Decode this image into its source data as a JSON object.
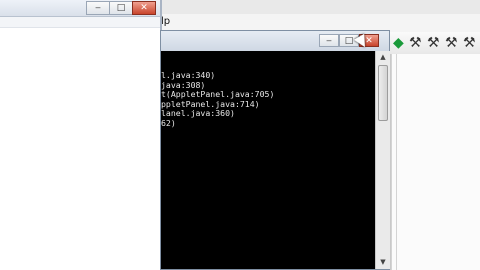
{
  "ide": {
    "menu_fragment": "lp"
  },
  "console": {
    "title_buttons": {
      "minimize": "‒",
      "maximize": "□",
      "close": "✕"
    },
    "lines": [
      "l.java:340)",
      "java:308)",
      "t(AppletPanel.java:705)",
      "ppletPanel.java:714)",
      "lanel.java:360)",
      "62)"
    ]
  },
  "left_window": {
    "title_buttons": {
      "minimize": "‒",
      "maximize": "□",
      "close": "✕"
    }
  },
  "colors": {
    "console_bg": "#000000",
    "console_text": "#e8e8e8",
    "accent_close": "#c8442c",
    "tool_green": "#1a9a3a"
  },
  "icons": {
    "toolbar_tools": [
      "green-gem-icon",
      "hammer-icon",
      "hammer-icon",
      "hammer-icon",
      "hammer-icon"
    ]
  }
}
